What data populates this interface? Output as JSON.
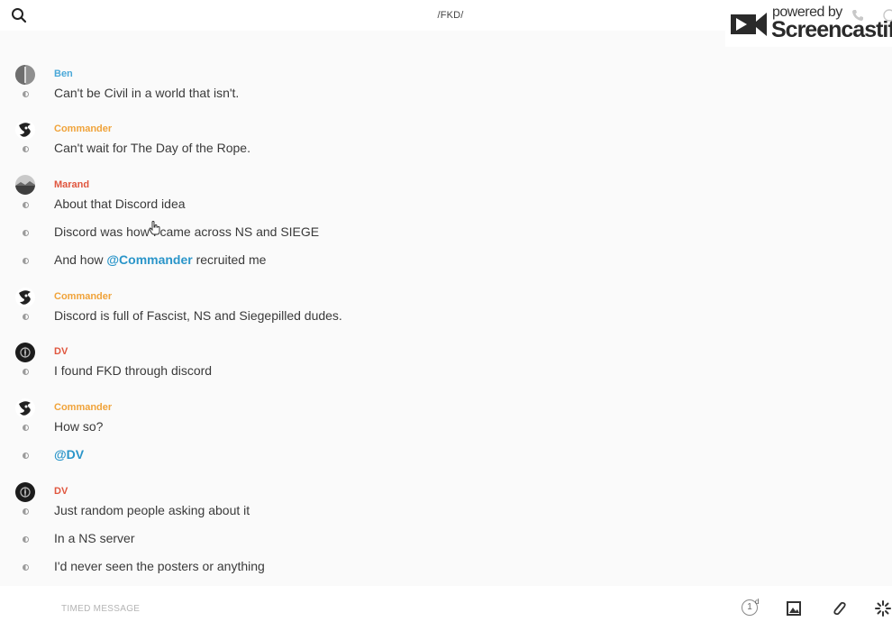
{
  "header": {
    "channel_title": "/FKD/"
  },
  "watermark": {
    "powered_by": "powered by",
    "brand": "Screencastify"
  },
  "colors": {
    "ben": "#4aa8d8",
    "commander": "#f0a33a",
    "marand": "#e0563e",
    "dv": "#e0563e",
    "mention": "#2a95c9"
  },
  "messages": [
    {
      "author": "Ben",
      "text": "Can't be Civil in a world that isn't."
    },
    {
      "author": "Commander",
      "text": "Can't wait for The Day of the Rope."
    },
    {
      "author": "Marand",
      "text": "About that Discord idea"
    },
    {
      "text": "Discord was how I came across NS and SIEGE"
    },
    {
      "text_before": "And how ",
      "mention": "@Commander",
      "text_after": " recruited me"
    },
    {
      "author": "Commander",
      "text": "Discord is full of Fascist, NS and Siegepilled dudes."
    },
    {
      "author": "DV",
      "text": "I found FKD through discord"
    },
    {
      "author": "Commander",
      "text": "How so?"
    },
    {
      "mention": "@DV"
    },
    {
      "author": "DV",
      "text": "Just random people asking about it"
    },
    {
      "text": "In a NS server"
    },
    {
      "text": "I'd never seen the posters or anything"
    }
  ],
  "composer": {
    "placeholder": "TIMED MESSAGE",
    "timer_value": "1",
    "timer_unit": "d"
  },
  "icons": {
    "search": "search-icon",
    "image": "image-icon",
    "attach": "paperclip-icon",
    "sparkle": "sparkle-icon"
  }
}
